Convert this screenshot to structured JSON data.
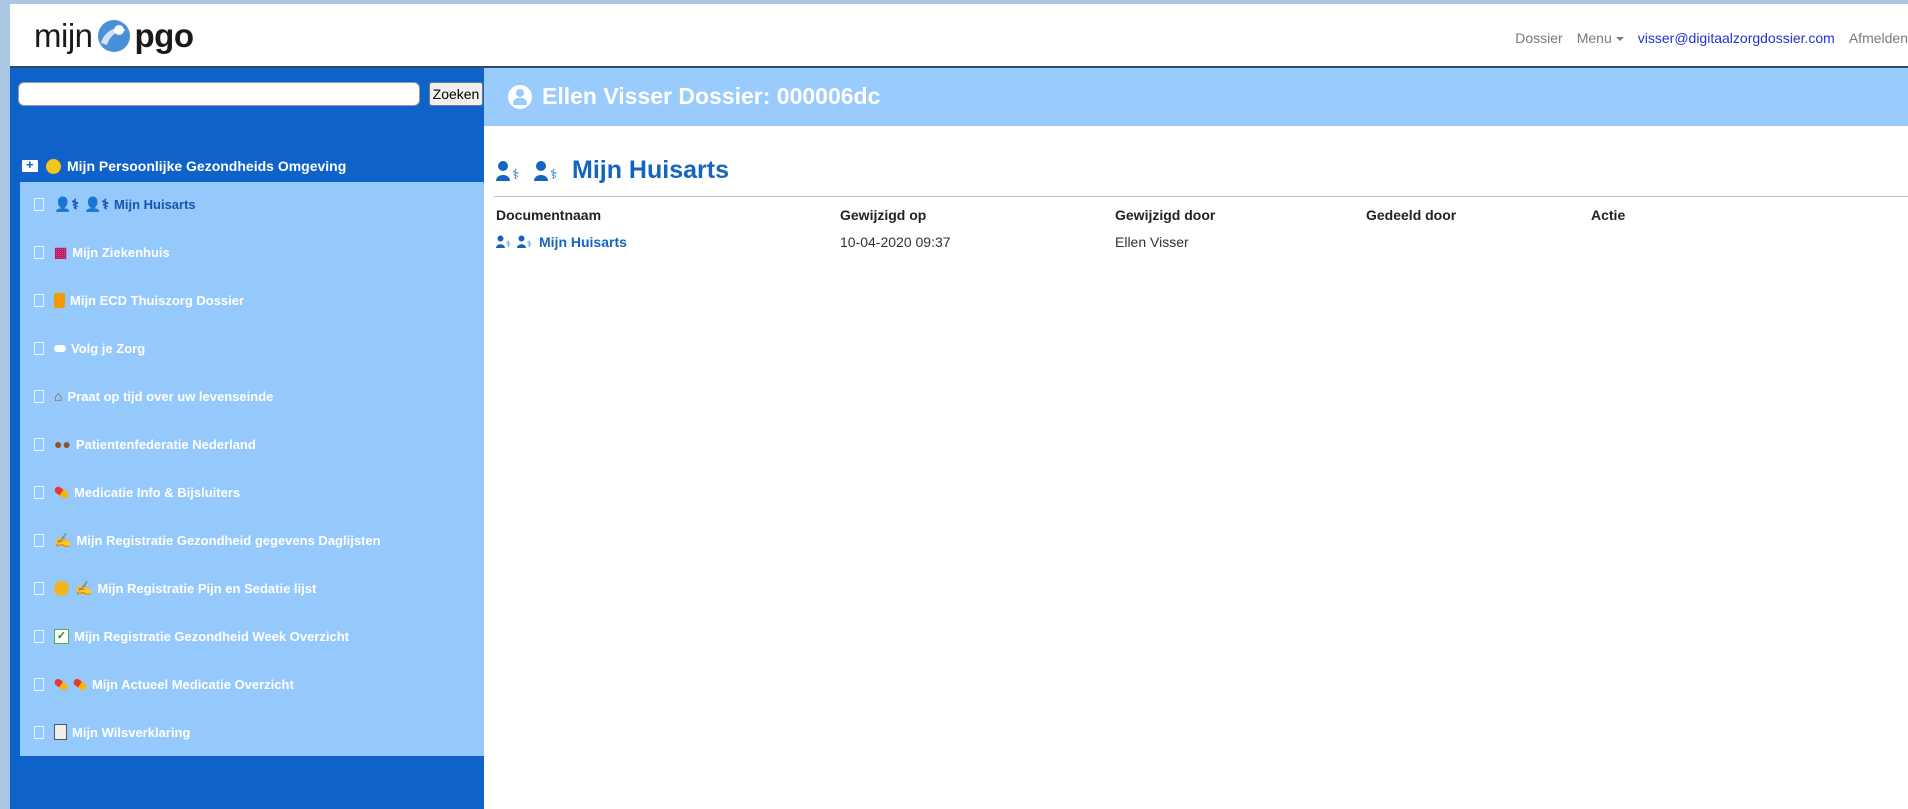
{
  "brand": {
    "logo_prefix": "mijn",
    "logo_suffix": "pgo",
    "logo_icon": "blue-swirl-logo-icon"
  },
  "topnav": {
    "dossier": "Dossier",
    "menu": "Menu",
    "email": "visser@digitaalzorgdossier.com",
    "logout": "Afmelden"
  },
  "search": {
    "value": "",
    "placeholder": "",
    "button": "Zoeken"
  },
  "sidebar": {
    "root": {
      "label": "Mijn Persoonlijke Gezondheids Omgeving",
      "icons": [
        "folder-plus-icon",
        "smiley-icon"
      ]
    },
    "items": [
      {
        "label": "Mijn Huisarts",
        "icons": [
          "doctor-icon",
          "doctor-icon"
        ],
        "active": true
      },
      {
        "label": "Mijn Ziekenhuis",
        "icons": [
          "hospital-icon"
        ]
      },
      {
        "label": "Mijn ECD Thuiszorg Dossier",
        "icons": [
          "orange-book-icon"
        ]
      },
      {
        "label": "Volg je Zorg",
        "icons": [
          "cloud-icon"
        ]
      },
      {
        "label": "Praat op tijd over uw levenseinde",
        "icons": [
          "house-icon"
        ]
      },
      {
        "label": "Patientenfederatie Nederland",
        "icons": [
          "people-icon"
        ]
      },
      {
        "label": "Medicatie Info & Bijsluiters",
        "icons": [
          "pill-icon"
        ]
      },
      {
        "label": "Mijn Registratie Gezondheid gegevens Daglijsten",
        "icons": [
          "writing-hand-icon"
        ]
      },
      {
        "label": "Mijn Registratie Pijn en Sedatie lijst",
        "icons": [
          "sad-face-icon",
          "writing-hand-icon"
        ]
      },
      {
        "label": "Mijn Registratie Gezondheid Week Overzicht",
        "icons": [
          "checkmark-chart-icon"
        ]
      },
      {
        "label": "Mijn Actueel Medicatie Overzicht",
        "icons": [
          "pill-icon",
          "pill-icon"
        ]
      },
      {
        "label": "Mijn Wilsverklaring",
        "icons": [
          "document-icon"
        ]
      }
    ]
  },
  "header": {
    "title": "Ellen Visser Dossier: 000006dc",
    "icon": "user-circle-icon"
  },
  "main": {
    "heading": "Mijn Huisarts",
    "columns": [
      "Documentnaam",
      "Gewijzigd op",
      "Gewijzigd door",
      "Gedeeld door",
      "Actie"
    ],
    "rows": [
      {
        "name": "Mijn Huisarts",
        "modified_on": "10-04-2020 09:37",
        "modified_by": "Ellen Visser",
        "shared_by": "",
        "action": ""
      }
    ]
  },
  "colors": {
    "sidebar": "#0e62c9",
    "submenu": "#96c9fb",
    "header": "#99cbfd",
    "link": "#1565c0"
  }
}
